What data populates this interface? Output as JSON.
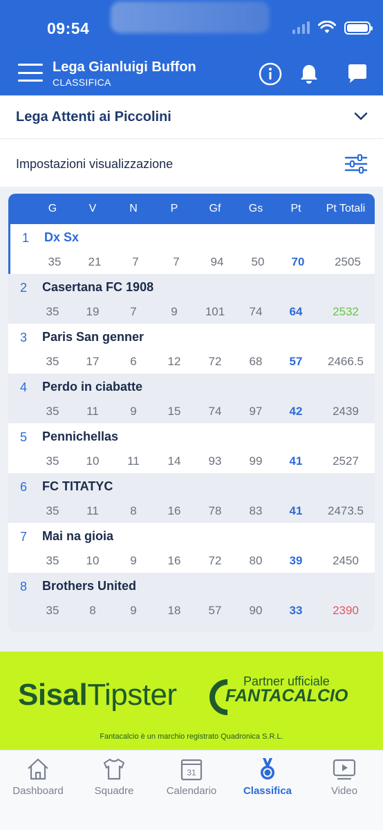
{
  "status_bar": {
    "time": "09:54"
  },
  "header": {
    "title": "Lega Gianluigi Buffon",
    "subtitle": "CLASSIFICA",
    "icons": [
      "menu-icon",
      "info-icon",
      "bell-icon",
      "chat-icon"
    ]
  },
  "league_selector": {
    "name": "Lega Attenti ai Piccolini"
  },
  "settings": {
    "label": "Impostazioni visualizzazione"
  },
  "table": {
    "columns": [
      "G",
      "V",
      "N",
      "P",
      "Gf",
      "Gs",
      "Pt",
      "Pt Totali"
    ],
    "rows": [
      {
        "rank": "1",
        "team": "Dx Sx",
        "g": "35",
        "v": "21",
        "n": "7",
        "p": "7",
        "gf": "94",
        "gs": "50",
        "pt": "70",
        "pt_totali": "2505"
      },
      {
        "rank": "2",
        "team": "Casertana FC 1908",
        "g": "35",
        "v": "19",
        "n": "7",
        "p": "9",
        "gf": "101",
        "gs": "74",
        "pt": "64",
        "pt_totali": "2532"
      },
      {
        "rank": "3",
        "team": "Paris San genner",
        "g": "35",
        "v": "17",
        "n": "6",
        "p": "12",
        "gf": "72",
        "gs": "68",
        "pt": "57",
        "pt_totali": "2466.5"
      },
      {
        "rank": "4",
        "team": "Perdo in ciabatte",
        "g": "35",
        "v": "11",
        "n": "9",
        "p": "15",
        "gf": "74",
        "gs": "97",
        "pt": "42",
        "pt_totali": "2439"
      },
      {
        "rank": "5",
        "team": "Pennichellas",
        "g": "35",
        "v": "10",
        "n": "11",
        "p": "14",
        "gf": "93",
        "gs": "99",
        "pt": "41",
        "pt_totali": "2527"
      },
      {
        "rank": "6",
        "team": "FC TITATYC",
        "g": "35",
        "v": "11",
        "n": "8",
        "p": "16",
        "gf": "78",
        "gs": "83",
        "pt": "41",
        "pt_totali": "2473.5"
      },
      {
        "rank": "7",
        "team": "Mai na gioia",
        "g": "35",
        "v": "10",
        "n": "9",
        "p": "16",
        "gf": "72",
        "gs": "80",
        "pt": "39",
        "pt_totali": "2450"
      },
      {
        "rank": "8",
        "team": "Brothers United",
        "g": "35",
        "v": "8",
        "n": "9",
        "p": "18",
        "gf": "57",
        "gs": "90",
        "pt": "33",
        "pt_totali": "2390"
      }
    ],
    "highest_total_color": "#6cc24a",
    "lowest_total_color": "#e25563"
  },
  "banner": {
    "brand_left_bold": "Sisal",
    "brand_left_regular": "Tipster",
    "partner_text": "Partner ufficiale",
    "partner_brand": "FANTACALCIO",
    "disclaimer": "Fantacalcio è un marchio registrato Quadronica S.R.L.",
    "background": "#c5f320"
  },
  "bottom_nav": {
    "items": [
      {
        "label": "Dashboard",
        "icon": "home-icon"
      },
      {
        "label": "Squadre",
        "icon": "shirt-icon"
      },
      {
        "label": "Calendario",
        "icon": "calendar-icon",
        "day": "31"
      },
      {
        "label": "Classifica",
        "icon": "medal-icon",
        "active": true
      },
      {
        "label": "Video",
        "icon": "video-icon"
      }
    ]
  },
  "colors": {
    "primary": "#2b6bd9",
    "text_dark": "#1b2a4a"
  }
}
